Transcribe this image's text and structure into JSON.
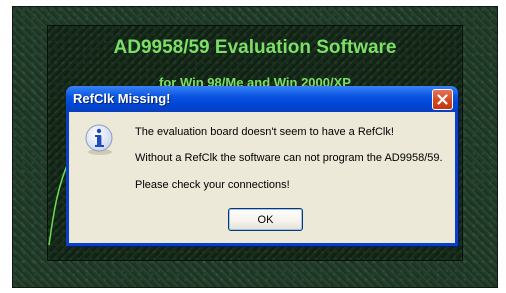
{
  "splash": {
    "title": "AD9958/59 Evaluation Software",
    "subtitle": "for Win 98/Me and Win 2000/XP"
  },
  "dialog": {
    "title": "RefClk Missing!",
    "message_1": "The evaluation board doesn't seem to have a RefClk!",
    "message_2": "Without a RefClk the software can not program the AD9958/59.",
    "message_3": "Please check your connections!",
    "ok_label": "OK",
    "icon": "info-icon",
    "colors": {
      "titlebar": "#0a55e0",
      "body": "#ece9d8",
      "close": "#d2451f",
      "splash_text": "#7be065"
    }
  }
}
